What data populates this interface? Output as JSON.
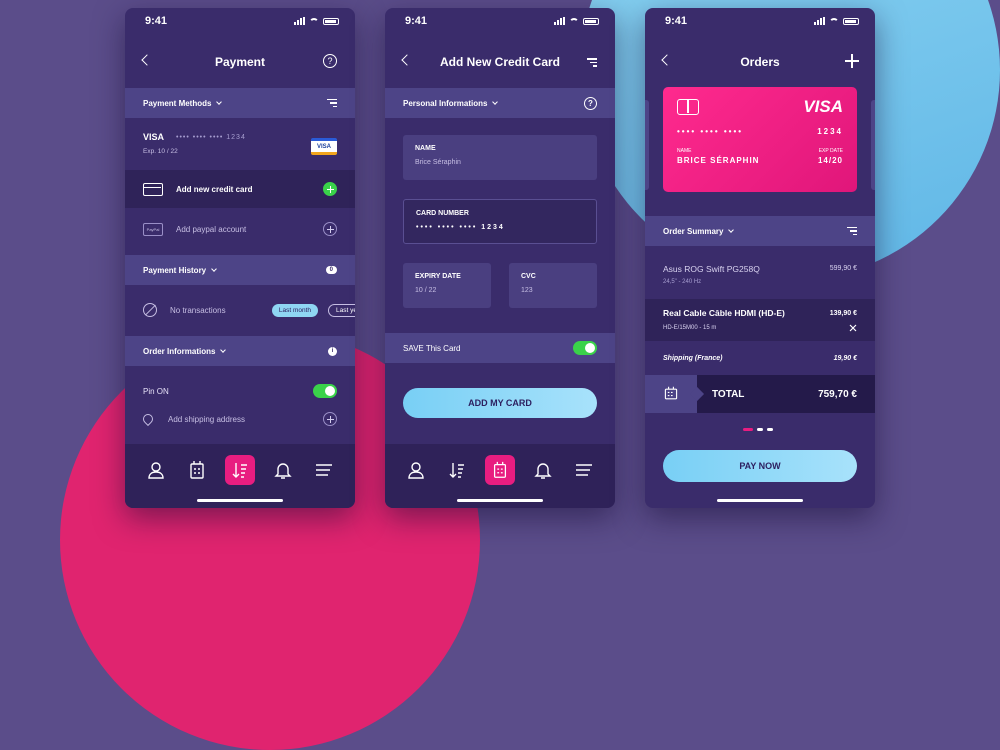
{
  "status_time": "9:41",
  "screen1": {
    "title": "Payment",
    "help_label": "?",
    "methods_header": "Payment Methods",
    "card_brand": "VISA",
    "card_masked": "•••• •••• •••• 1234",
    "card_exp": "Exp. 10 / 22",
    "card_badge": "VISA",
    "add_card": "Add new credit card",
    "paypal_badge": "PayPal",
    "add_paypal": "Add paypal account",
    "history_header": "Payment History",
    "history_count": "0",
    "no_transactions": "No transactions",
    "chip_last_month": "Last month",
    "chip_last_year": "Last ye",
    "order_header": "Order Informations",
    "info_label": "i",
    "pin_on": "Pin ON",
    "add_shipping": "Add shipping address"
  },
  "screen2": {
    "title": "Add New Credit Card",
    "personal_header": "Personal Informations",
    "help_label": "?",
    "name_label": "NAME",
    "name_value": "Brice Séraphin",
    "card_number_label": "CARD NUMBER",
    "card_number_value": "•••• •••• •••• 1234",
    "expiry_label": "EXPIRY DATE",
    "expiry_value": "10 / 22",
    "cvc_label": "CVC",
    "cvc_value": "123",
    "save_card": "SAVE This Card",
    "add_button": "ADD MY CARD"
  },
  "screen3": {
    "title": "Orders",
    "card_brand": "VISA",
    "card_dots": "••••   ••••   ••••",
    "card_last": "1234",
    "card_name_label": "NAME",
    "card_name": "BRICE SÉRAPHIN",
    "card_exp_label": "EXP DATE",
    "card_exp": "14/20",
    "summary_header": "Order Summary",
    "item1_name": "Asus ROG Swift PG258Q",
    "item1_price": "599,90 €",
    "item1_sub": "24,5\" - 240 Hz",
    "item2_name": "Real Cable Câble HDMI (HD-E)",
    "item2_price": "139,90 €",
    "item2_sub": "HD-E/15M00 - 15 m",
    "shipping_label": "Shipping (France)",
    "shipping_price": "19,90 €",
    "total_label": "TOTAL",
    "total_value": "759,70 €",
    "pay_button": "PAY NOW"
  },
  "colors": {
    "accent_pink": "#e81d80",
    "accent_green": "#3ad24a",
    "accent_blue": "#8fd6f3",
    "background": "#5b4d8a"
  }
}
